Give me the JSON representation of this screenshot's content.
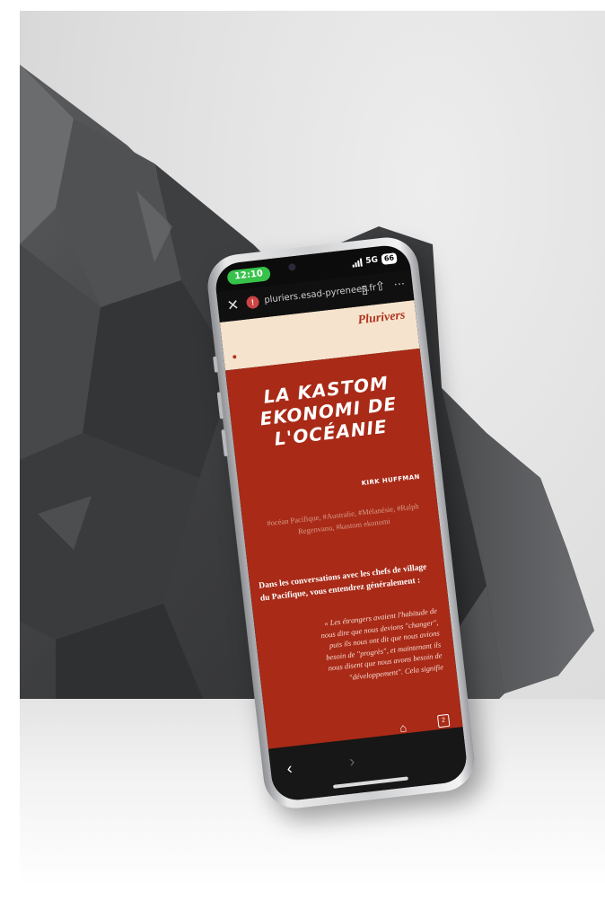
{
  "status_bar": {
    "time": "12:10",
    "network": "5G",
    "battery": "66"
  },
  "browser": {
    "url": "pluriers.esad-pyrenees.fr",
    "close_icon": "close-icon",
    "bookmark_icon": "bookmark-icon",
    "share_icon": "share-icon",
    "more_icon": "more-icon"
  },
  "page": {
    "brand": "Plurivers",
    "title_lines": [
      "LA KASTOM",
      "EKONOMI DE",
      "L'OCÉANIE"
    ],
    "author": "KIRK HUFFMAN",
    "tags": "#océan Pacifique, #Australie, #Mélanésie, #Ralph Regenvanu, #kastom ekonomi",
    "intro": "Dans les conversations avec les chefs de village du Pacifique, vous entendrez généralement :",
    "quote": "« Les étrangers avaient l'habitude de nous dire que nous devions \"changer\", puis ils nous ont dit que nous avions besoin de \"progrès\", et maintenant ils nous disent que nous avons besoin de \"développement\". Cela signifie"
  },
  "toolbar": {
    "back_icon": "chevron-left-icon",
    "forward_icon": "chevron-right-icon",
    "home_icon": "home-icon",
    "tabs_count": "2"
  },
  "colors": {
    "article_bg": "#a82a17",
    "header_bg": "#f6e3cd",
    "accent": "#b0341f",
    "status_green": "#37c24a"
  }
}
